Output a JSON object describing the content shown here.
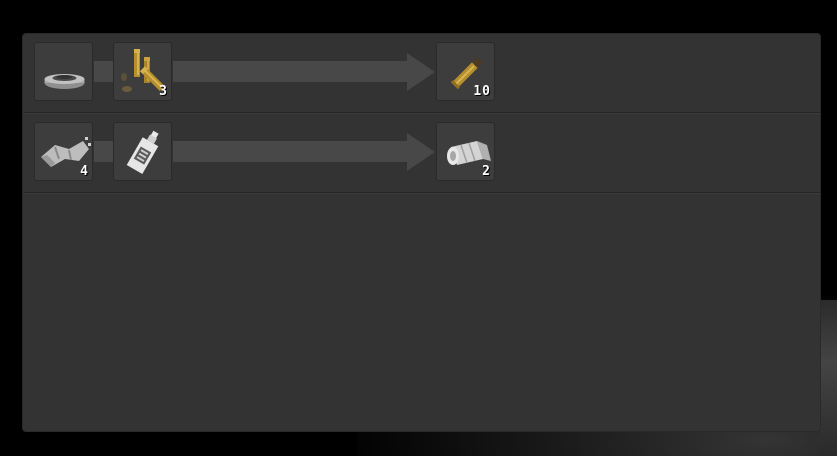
{
  "recipes": [
    {
      "inputs": [
        {
          "icon": "gunpowder-dish-icon",
          "count": ""
        },
        {
          "icon": "brass-casings-icon",
          "count": "3"
        }
      ],
      "output": {
        "icon": "rifle-cartridge-icon",
        "count": "10"
      }
    },
    {
      "inputs": [
        {
          "icon": "cloth-rag-icon",
          "count": "4"
        },
        {
          "icon": "disinfectant-bottle-icon",
          "count": ""
        }
      ],
      "output": {
        "icon": "bandage-roll-icon",
        "count": "2"
      }
    }
  ],
  "colors": {
    "panel": "#333333",
    "slot": "#3d3d3d",
    "arrow": "#484848",
    "brass": "#b58f2e",
    "count_text": "#ffffff"
  }
}
